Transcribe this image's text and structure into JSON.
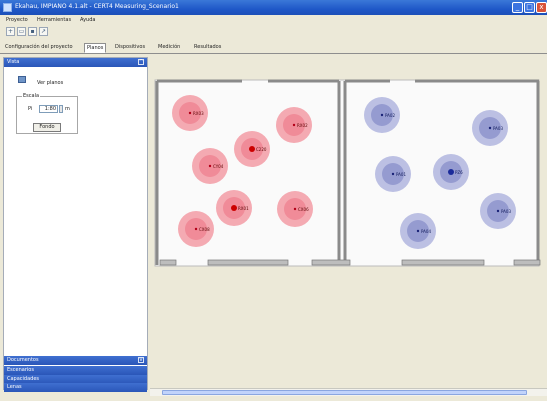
{
  "window": {
    "title": "Ekahau, IMPIANO 4.1.alt - CERT4 Measuring_Scenario1",
    "minimize": "_",
    "maximize": "□",
    "close": "x"
  },
  "menu": {
    "items": [
      "Proyecto",
      "Herramientas",
      "Ayuda"
    ]
  },
  "toolbar": {
    "icons": [
      "new-icon",
      "open-icon",
      "save-icon",
      "export-icon"
    ]
  },
  "tabs": {
    "items": [
      {
        "label": "Configuración del proyecto",
        "active": false
      },
      {
        "label": "Planos",
        "active": true
      },
      {
        "label": "Dispositivos",
        "active": false
      },
      {
        "label": "Medición",
        "active": false
      },
      {
        "label": "Resultados",
        "active": false
      }
    ]
  },
  "left_panel": {
    "section_top": "Vista",
    "zoom_label": "Ver planos",
    "scale": {
      "legend": "Escala",
      "row_label": "Pi",
      "value": "1:80",
      "unit": "m",
      "button": "Fondo"
    },
    "collapsed_sections": [
      "Documentos",
      "Escenarios",
      "Capacidades",
      "Lenas"
    ]
  },
  "floorplan": {
    "colors": {
      "red_halo": "#f3a5ad",
      "red_core": "#ee8794",
      "blue_halo": "#b8bde2",
      "blue_core": "#8d95cd",
      "wall": "#7f7f7f",
      "door": "#bdbdbd"
    },
    "red_nodes": [
      {
        "label": "RX03",
        "active": false
      },
      {
        "label": "RX02",
        "active": false
      },
      {
        "label": "C220",
        "active": true
      },
      {
        "label": "CY04",
        "active": false
      },
      {
        "label": "RX01",
        "active": true
      },
      {
        "label": "CX06",
        "active": false
      },
      {
        "label": "CX08",
        "active": false
      }
    ],
    "blue_nodes": [
      {
        "label": "PA02",
        "active": false
      },
      {
        "label": "PA03",
        "active": false
      },
      {
        "label": "PA01",
        "active": false
      },
      {
        "label": "PZ6",
        "active": true
      },
      {
        "label": "PA03",
        "active": false
      },
      {
        "label": "PA04",
        "active": false
      }
    ]
  }
}
